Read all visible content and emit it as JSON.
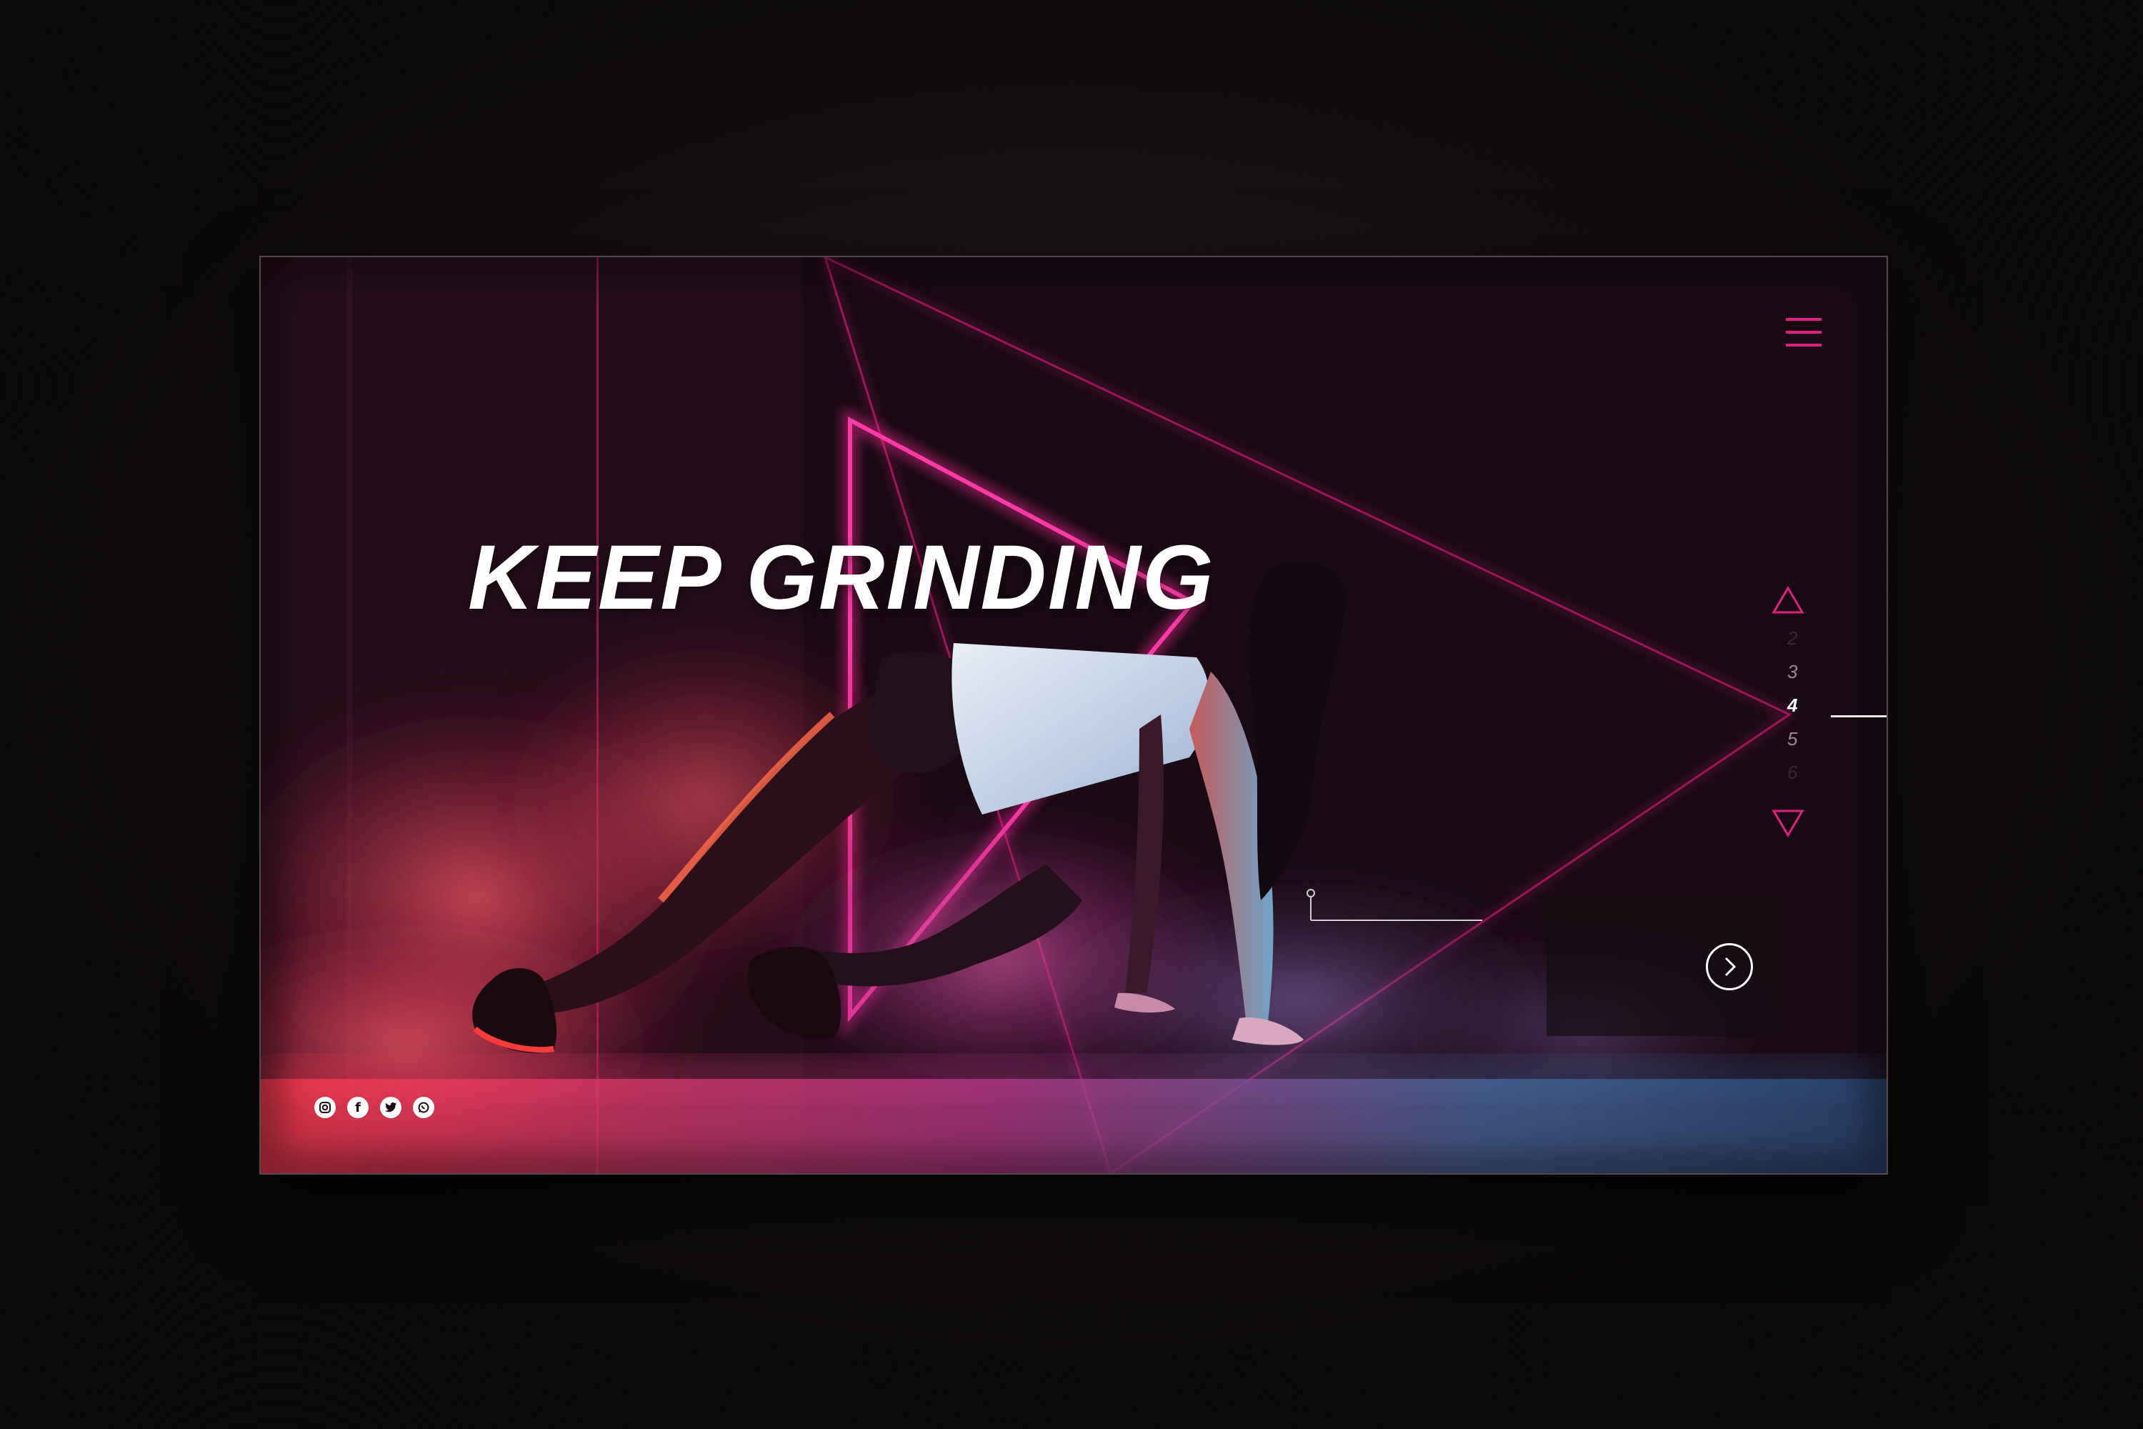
{
  "hero": {
    "title": "KEEP GRINDING"
  },
  "slide_nav": {
    "items": [
      "2",
      "3",
      "4",
      "5",
      "6"
    ],
    "active": "4"
  },
  "social": [
    {
      "name": "instagram-icon"
    },
    {
      "name": "facebook-icon",
      "glyph": "f"
    },
    {
      "name": "twitter-icon"
    },
    {
      "name": "whatsapp-icon"
    }
  ],
  "colors": {
    "accent": "#e0207f",
    "background": "#140a10",
    "text": "#ffffff"
  }
}
